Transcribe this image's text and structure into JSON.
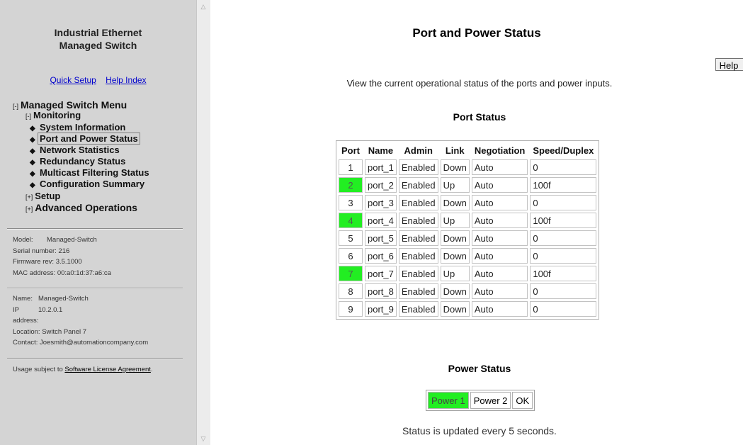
{
  "sidebar": {
    "product_line1": "Industrial Ethernet",
    "product_line2": "Managed Switch",
    "links": {
      "quick_setup": "Quick Setup",
      "help_index": "Help Index"
    },
    "menu": {
      "root": {
        "toggle": "[-]",
        "label": "Managed Switch Menu"
      },
      "monitoring": {
        "toggle": "[-]",
        "label": "Monitoring"
      },
      "monitoring_items": [
        "System Information",
        "Port and Power Status",
        "Network Statistics",
        "Redundancy Status",
        "Multicast Filtering Status",
        "Configuration Summary"
      ],
      "active_item": "Port and Power Status",
      "setup": {
        "toggle": "[+]",
        "label": "Setup"
      },
      "advanced": {
        "toggle": "[+]",
        "label": "Advanced Operations"
      }
    },
    "device": {
      "model_label": "Model:",
      "model": "Managed-Switch",
      "serial_label": "Serial number:",
      "serial": "216",
      "firmware_label": "Firmware rev:",
      "firmware": "3.5.1000",
      "mac_label": "MAC address:",
      "mac": "00:a0:1d:37:a6:ca"
    },
    "identity": {
      "name_label": "Name:",
      "name": "Managed-Switch",
      "ip_label1": "IP",
      "ip_label2": "address:",
      "ip": "10.2.0.1",
      "location_label": "Location:",
      "location": "Switch Panel 7",
      "contact_label": "Contact:",
      "contact": "Joesmith@automationcompany.com"
    },
    "license": {
      "prefix": "Usage subject to ",
      "link": "Software License Agreement",
      "suffix": "."
    }
  },
  "main": {
    "title": "Port and Power Status",
    "help_button": "Help",
    "description": "View the current operational status of the ports and power inputs.",
    "port_section_title": "Port Status",
    "port_table": {
      "columns": [
        "Port",
        "Name",
        "Admin",
        "Link",
        "Negotiation",
        "Speed/Duplex"
      ],
      "rows": [
        {
          "port": "1",
          "name": "port_1",
          "admin": "Enabled",
          "link": "Down",
          "negotiation": "Auto",
          "speed": "0",
          "link_up": false
        },
        {
          "port": "2",
          "name": "port_2",
          "admin": "Enabled",
          "link": "Up",
          "negotiation": "Auto",
          "speed": "100f",
          "link_up": true
        },
        {
          "port": "3",
          "name": "port_3",
          "admin": "Enabled",
          "link": "Down",
          "negotiation": "Auto",
          "speed": "0",
          "link_up": false
        },
        {
          "port": "4",
          "name": "port_4",
          "admin": "Enabled",
          "link": "Up",
          "negotiation": "Auto",
          "speed": "100f",
          "link_up": true
        },
        {
          "port": "5",
          "name": "port_5",
          "admin": "Enabled",
          "link": "Down",
          "negotiation": "Auto",
          "speed": "0",
          "link_up": false
        },
        {
          "port": "6",
          "name": "port_6",
          "admin": "Enabled",
          "link": "Down",
          "negotiation": "Auto",
          "speed": "0",
          "link_up": false
        },
        {
          "port": "7",
          "name": "port_7",
          "admin": "Enabled",
          "link": "Up",
          "negotiation": "Auto",
          "speed": "100f",
          "link_up": true
        },
        {
          "port": "8",
          "name": "port_8",
          "admin": "Enabled",
          "link": "Down",
          "negotiation": "Auto",
          "speed": "0",
          "link_up": false
        },
        {
          "port": "9",
          "name": "port_9",
          "admin": "Enabled",
          "link": "Down",
          "negotiation": "Auto",
          "speed": "0",
          "link_up": false
        }
      ]
    },
    "power_section_title": "Power Status",
    "power": [
      {
        "label": "Power 1",
        "ok": true
      },
      {
        "label": "Power 2",
        "ok": false
      }
    ],
    "power_status": "OK",
    "update_note": "Status is updated every 5 seconds."
  },
  "colors": {
    "status_up": "#22ee22",
    "sidebar_bg": "#d4d4d4",
    "link": "#0000cc"
  },
  "icons": {
    "scroll_up": "scroll-up-arrow-icon",
    "scroll_down": "scroll-down-arrow-icon",
    "menu_bullet": "bullet-icon"
  }
}
